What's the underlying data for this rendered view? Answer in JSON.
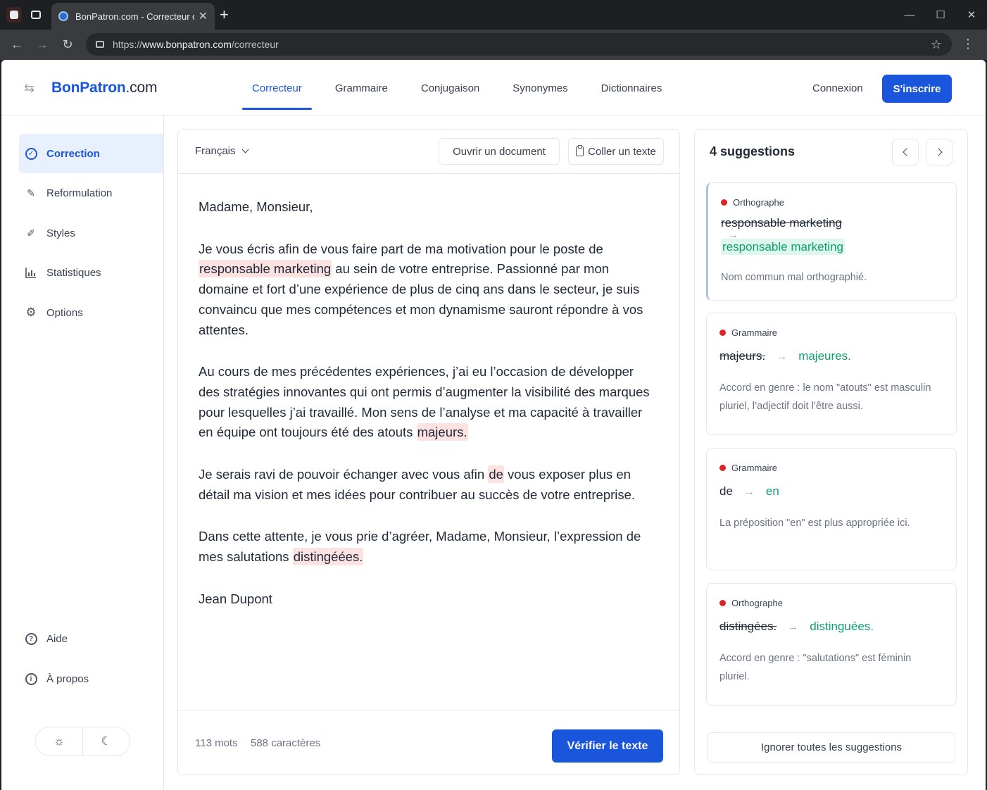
{
  "browser": {
    "tab_title": "BonPatron.com - Correcteur d'o",
    "url_prefix": "https://",
    "url_host": "www.bonpatron.com",
    "url_path": "/correcteur"
  },
  "header": {
    "brand_main": "BonPatron",
    "brand_suffix": ".com",
    "nav": [
      "Correcteur",
      "Grammaire",
      "Conjugaison",
      "Synonymes",
      "Dictionnaires"
    ],
    "login": "Connexion",
    "signup": "S'inscrire"
  },
  "sidebar": {
    "items": [
      {
        "label": "Correction",
        "icon": "check-circle-icon"
      },
      {
        "label": "Reformulation",
        "icon": "edit-icon"
      },
      {
        "label": "Styles",
        "icon": "pen-icon"
      },
      {
        "label": "Statistiques",
        "icon": "chart-icon"
      },
      {
        "label": "Options",
        "icon": "gear-icon"
      }
    ],
    "bottom": [
      {
        "label": "Aide",
        "icon": "help-icon"
      },
      {
        "label": "À propos",
        "icon": "info-icon"
      }
    ]
  },
  "editor": {
    "language": "Français",
    "open_doc": "Ouvrir un document",
    "paste_text": "Coller un texte",
    "greeting": "Madame, Monsieur,",
    "p1_a": "Je vous écris afin de vous faire part de ma motivation pour le poste de ",
    "p1_hl": "responsable marketing",
    "p1_b": " au sein de votre entreprise. Passionné par mon domaine et fort d’une expérience de plus de cinq ans dans le secteur, je suis convaincu que mes compétences et mon dynamisme sauront répondre à vos attentes.",
    "p2_a": "Au cours de mes précédentes expériences, j’ai eu l’occasion de développer des stratégies innovantes qui ont permis d’augmenter la visibilité des marques pour lesquelles j’ai travaillé. Mon sens de l’analyse et ma capacité à travailler en équipe ont toujours été des atouts ",
    "p2_hl": "majeurs.",
    "p3_a": "Je serais ravi de pouvoir échanger avec vous afin ",
    "p3_hl": "de",
    "p3_b": " vous exposer plus en détail ma vision et mes idées pour contribuer au succès de votre entreprise.",
    "p4_a": "Dans cette attente, je vous prie d’agréer, Madame, Monsieur, l’expression de mes salutations ",
    "p4_hl": "distingéées.",
    "signature": "Jean Dupont",
    "words": "113 mots",
    "chars": "588 caractères",
    "verify": "Vérifier le texte"
  },
  "suggestions": {
    "title": "4 suggestions",
    "ignore_all": "Ignorer toutes les suggestions",
    "items": [
      {
        "category": "Orthographe",
        "from": "responsable marketing",
        "to": "responsable marketing",
        "explanation": "Nom commun mal orthographié."
      },
      {
        "category": "Grammaire",
        "from": "majeurs.",
        "to": "majeures.",
        "explanation": "Accord en genre : le nom \"atouts\" est masculin pluriel, l’adjectif doit l’être aussi."
      },
      {
        "category": "Grammaire",
        "from": "de",
        "to": "en",
        "explanation": "La préposition \"en\" est plus appropriée ici."
      },
      {
        "category": "Orthographe",
        "from": "distingées.",
        "to": "distinguées.",
        "explanation": "Accord en genre : \"salutations\" est féminin pluriel."
      }
    ]
  },
  "colors": {
    "accent": "#1a56db",
    "error": "#e02424",
    "correction": "#0e9f6e",
    "highlight": "#fde2e2"
  }
}
